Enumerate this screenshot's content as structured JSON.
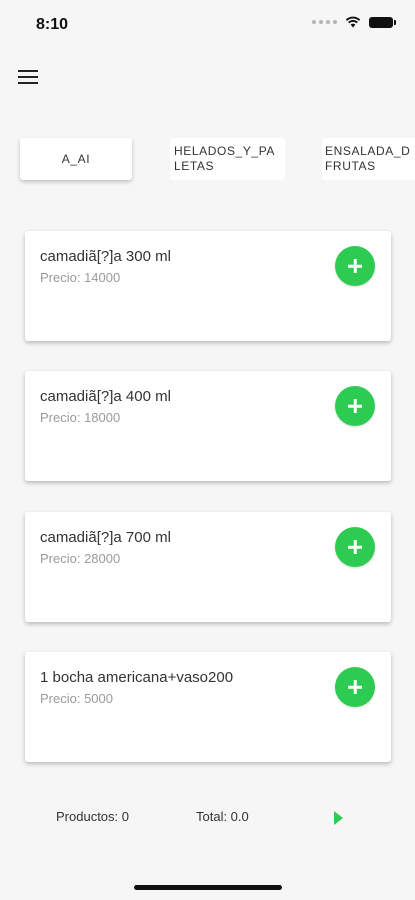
{
  "status_bar": {
    "time": "8:10"
  },
  "menu": {
    "icon": "hamburger-menu-icon"
  },
  "tabs": [
    {
      "label": "A_AI",
      "active": true
    },
    {
      "label": "HELADOS_Y_PA\nLETAS",
      "active": false
    },
    {
      "label": "ENSALADA_D\nFRUTAS",
      "active": false
    }
  ],
  "products": [
    {
      "name": "camadiã[?]a 300 ml",
      "price": "Precio: 14000"
    },
    {
      "name": "camadiã[?]a 400 ml",
      "price": "Precio: 18000"
    },
    {
      "name": "camadiã[?]a 700 ml",
      "price": "Precio: 28000"
    },
    {
      "name": "1 bocha americana+vaso200",
      "price": "Precio: 5000"
    }
  ],
  "footer": {
    "products_label": "Productos: 0",
    "total_label": "Total: 0.0"
  },
  "colors": {
    "accent": "#2ecb52",
    "background": "#f6f6f6",
    "card": "#ffffff"
  }
}
